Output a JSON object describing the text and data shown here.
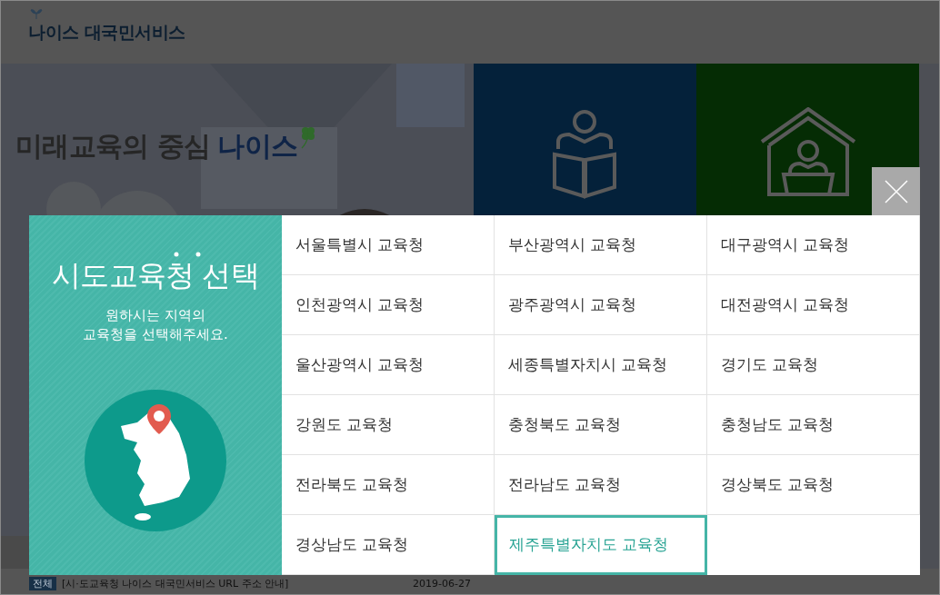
{
  "header": {
    "logo": "나이스 대국민서비스"
  },
  "banner": {
    "headline": "미래교육의 중심",
    "headline_brand": "나이스"
  },
  "notice": {
    "tag": "전체",
    "title": "[시·도교육청 나이스 대국민서비스 URL 주소 안내]",
    "date": "2019-06-27"
  },
  "modal": {
    "title": "시도교육청 선택",
    "subtitle": "원하시는 지역의",
    "subtitle_2": "교육청을 선택해주세요.",
    "offices": [
      {
        "label": "서울특별시 교육청",
        "selected": false
      },
      {
        "label": "부산광역시 교육청",
        "selected": false
      },
      {
        "label": "대구광역시 교육청",
        "selected": false
      },
      {
        "label": "인천광역시 교육청",
        "selected": false
      },
      {
        "label": "광주광역시 교육청",
        "selected": false
      },
      {
        "label": "대전광역시 교육청",
        "selected": false
      },
      {
        "label": "울산광역시 교육청",
        "selected": false
      },
      {
        "label": "세종특별자치시 교육청",
        "selected": false
      },
      {
        "label": "경기도 교육청",
        "selected": false
      },
      {
        "label": "강원도 교육청",
        "selected": false
      },
      {
        "label": "충청북도 교육청",
        "selected": false
      },
      {
        "label": "충청남도 교육청",
        "selected": false
      },
      {
        "label": "전라북도 교육청",
        "selected": false
      },
      {
        "label": "전라남도 교육청",
        "selected": false
      },
      {
        "label": "경상북도 교육청",
        "selected": false
      },
      {
        "label": "경상남도 교육청",
        "selected": false
      },
      {
        "label": "제주특별자치도 교육청",
        "selected": true
      }
    ]
  }
}
